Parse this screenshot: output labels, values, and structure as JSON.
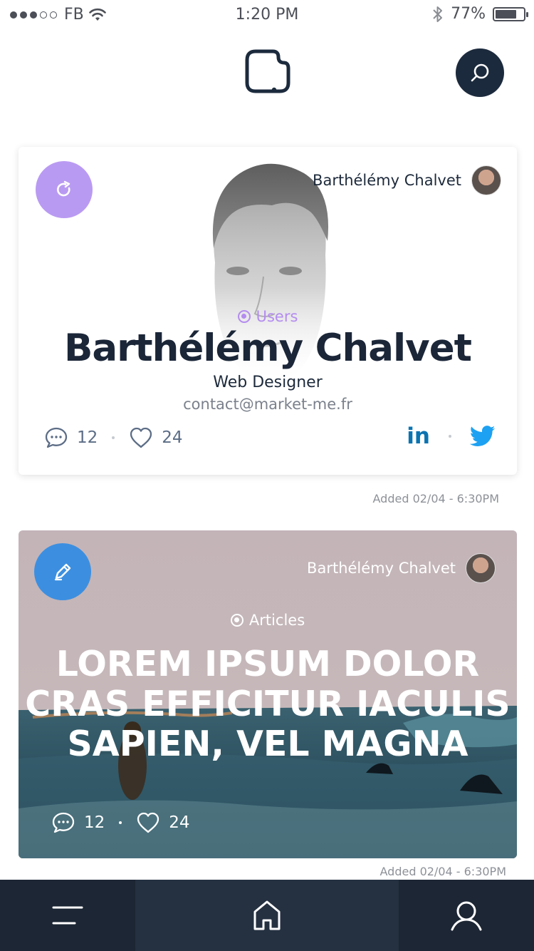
{
  "status_bar": {
    "carrier": "FB",
    "time": "1:20 PM",
    "battery": "77%",
    "battery_level": 0.77
  },
  "header": {
    "logo_icon": "app-logo-icon",
    "search_icon": "search-icon"
  },
  "cards": [
    {
      "badge_icon": "refresh-icon",
      "badge_color": "#b99af2",
      "author_name": "Barthélémy Chalvet",
      "category": "Users",
      "category_color": "#b48cf0",
      "title": "Barthélémy Chalvet",
      "role": "Web Designer",
      "email": "contact@market-me.fr",
      "comments": "12",
      "likes": "24",
      "socials": [
        "linkedin",
        "twitter"
      ],
      "linkedin_label": "in",
      "added": "Added 02/04 - 6:30PM"
    },
    {
      "badge_icon": "pencil-icon",
      "badge_color": "#3c8fe0",
      "author_name": "Barthélémy Chalvet",
      "category": "Articles",
      "headline_lines": [
        "LOREM IPSUM DOLOR",
        "CRAS EFFICITUR IACULIS",
        "SAPIEN, VEL MAGNA"
      ],
      "comments": "12",
      "likes": "24",
      "added": "Added 02/04 - 6:30PM"
    }
  ],
  "tab_bar": {
    "items": [
      "menu-icon",
      "home-icon",
      "profile-icon"
    ],
    "active": "home-icon"
  },
  "colors": {
    "navy": "#1c2634",
    "linkedin": "#0a73b1",
    "twitter": "#1da1f2"
  }
}
